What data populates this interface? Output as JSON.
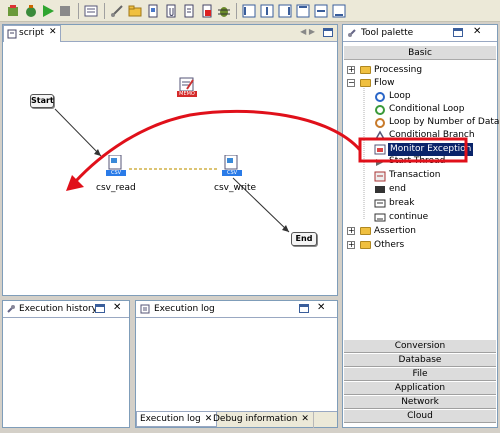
{
  "editor": {
    "tab_label": "script",
    "nodes": {
      "start": "Start",
      "end": "End",
      "csv_read": "csv_read",
      "csv_write": "csv_write",
      "csv_tag": "CSV",
      "memo_tag": "MEMO"
    }
  },
  "tool_palette": {
    "title": "Tool palette",
    "section_basic": "Basic",
    "tree": {
      "processing": "Processing",
      "flow": "Flow",
      "loop": "Loop",
      "conditional_loop": "Conditional Loop",
      "loop_by_number": "Loop by Number of Data",
      "conditional_branch": "Conditional Branch",
      "monitor_exception": "Monitor Exception",
      "start_thread": "Start Thread",
      "transaction": "Transaction",
      "end": "end",
      "break": "break",
      "continue": "continue",
      "assertion": "Assertion",
      "others": "Others"
    },
    "categories": [
      "Conversion",
      "Database",
      "File",
      "Application",
      "Network",
      "Cloud"
    ]
  },
  "execution_history": {
    "title": "Execution history"
  },
  "execution_log": {
    "title": "Execution log",
    "bottom_tabs": [
      "Execution log",
      "Debug information"
    ]
  },
  "colors": {
    "selection": "#0a246a",
    "annotation_red": "#e0101a",
    "csv_blue": "#2a7be8"
  }
}
